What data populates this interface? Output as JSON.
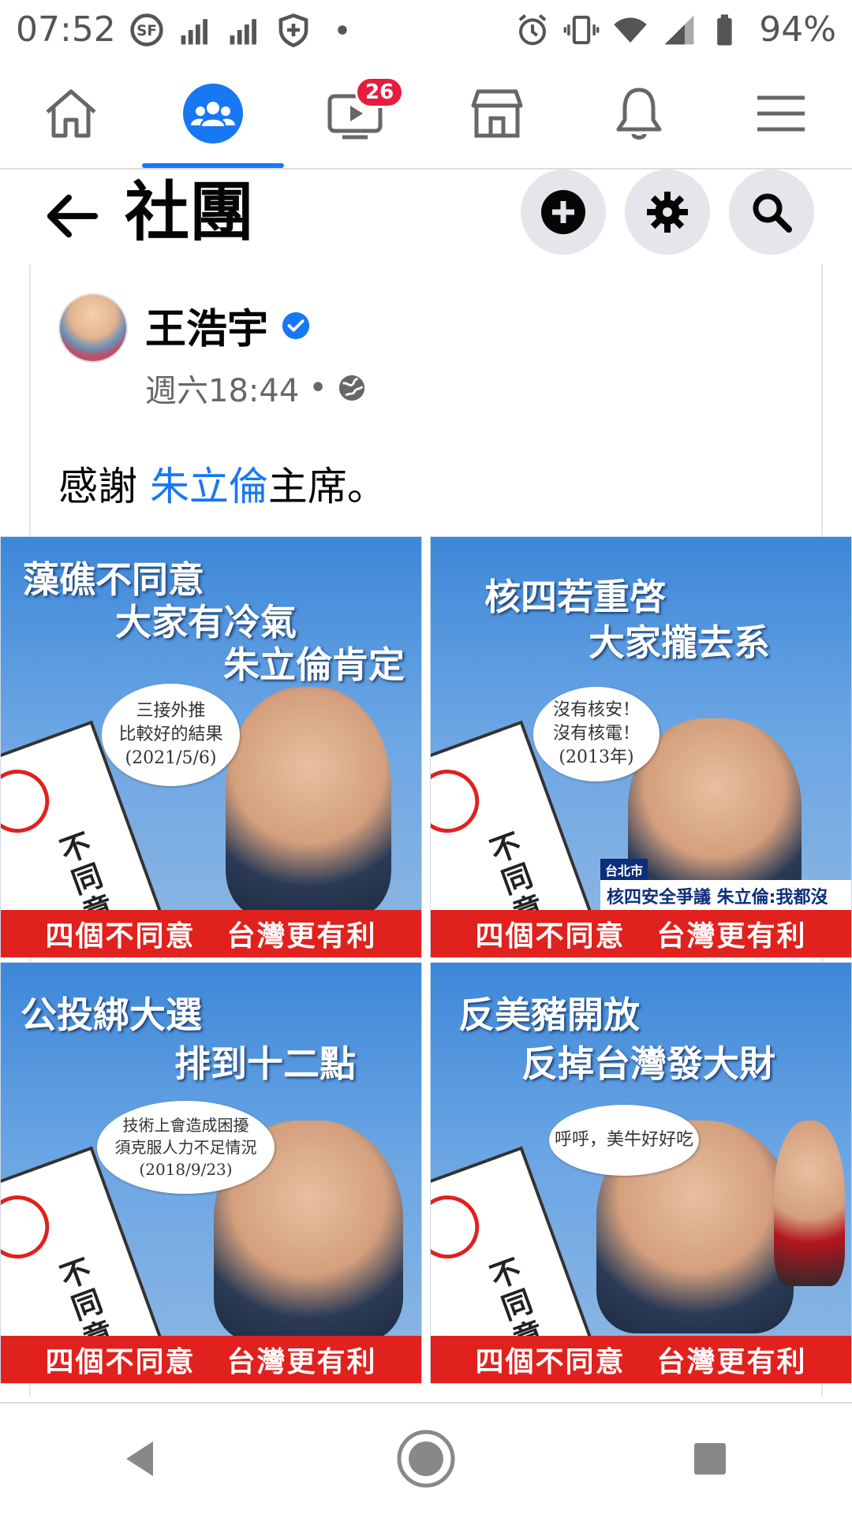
{
  "status_bar": {
    "time": "07:52",
    "battery": "94%",
    "left_icons": [
      "sf-express-icon",
      "signal-icon",
      "signal-icon",
      "shield-icon",
      "dot-icon"
    ],
    "right_icons": [
      "alarm-icon",
      "vibrate-icon",
      "wifi-icon",
      "cell-signal-icon",
      "battery-icon"
    ]
  },
  "nav": {
    "tabs": [
      {
        "name": "home",
        "icon": "home-icon"
      },
      {
        "name": "groups",
        "icon": "groups-icon",
        "active": true
      },
      {
        "name": "watch",
        "icon": "video-icon",
        "badge": "26"
      },
      {
        "name": "marketplace",
        "icon": "store-icon"
      },
      {
        "name": "notifications",
        "icon": "bell-icon"
      },
      {
        "name": "menu",
        "icon": "hamburger-icon"
      }
    ],
    "accent": "#1877f2"
  },
  "header": {
    "title": "社團",
    "actions": [
      "add-icon",
      "gear-icon",
      "search-icon"
    ]
  },
  "post": {
    "author": "王浩宇",
    "verified": true,
    "time": "週六18:44",
    "separator": "•",
    "privacy_icon": "globe-icon",
    "text_before": "感謝 ",
    "mention": "朱立倫",
    "text_after": "主席。"
  },
  "images": [
    {
      "lines": [
        "藻礁不同意",
        "大家有冷氣",
        "朱立倫肯定"
      ],
      "bubble": [
        "三接外推",
        "比較好的結果",
        "(2021/5/6)"
      ],
      "ballot_text": "不同意",
      "footer_left": "四個不同意",
      "footer_right": "台灣更有利"
    },
    {
      "lines": [
        "核四若重啓",
        "大家攏去系"
      ],
      "bubble": [
        "沒有核安！",
        "沒有核電！",
        "(2013年)"
      ],
      "ballot_text": "不同意",
      "caption_small": "台北市",
      "caption": "核四安全爭議 朱立倫:我都沒信心",
      "footer_left": "四個不同意",
      "footer_right": "台灣更有利"
    },
    {
      "lines": [
        "公投綁大選",
        "排到十二點"
      ],
      "bubble": [
        "技術上會造成困擾",
        "須克服人力不足情況",
        "(2018/9/23)"
      ],
      "ballot_text": "不同意",
      "footer_left": "四個不同意",
      "footer_right": "台灣更有利"
    },
    {
      "lines": [
        "反美豬開放",
        "反掉台灣發大財"
      ],
      "bubble": [
        "呼呼，美牛好好吃"
      ],
      "ballot_text": "不同意",
      "footer_left": "四個不同意",
      "footer_right": "台灣更有利"
    }
  ],
  "android_nav": [
    "back-icon",
    "home-circle-icon",
    "recents-icon"
  ]
}
